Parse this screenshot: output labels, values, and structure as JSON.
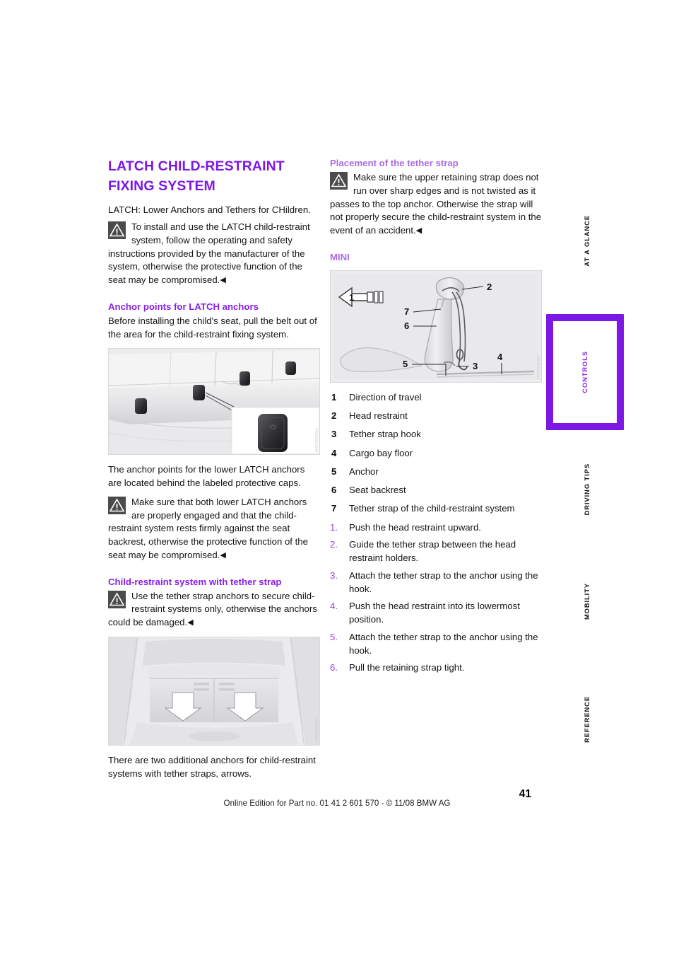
{
  "document": {
    "page_number": "41",
    "footer_text": "Online Edition for Part no. 01 41 2 601 570 - © 11/08 BMW AG"
  },
  "colors": {
    "heading_primary": "#7d17e6",
    "heading_secondary": "#8a1fe8",
    "heading_light": "#a96ce6",
    "step_number": "#9b3fe8",
    "active_tab": "#7d17e6"
  },
  "left_column": {
    "title": "LATCH CHILD-RESTRAINT FIXING SYSTEM",
    "intro": "LATCH: Lower Anchors and Tethers for CHildren.",
    "warning_1": "To install and use the LATCH child-restraint system, follow the operating and safety instructions provided by the manufacturer of the system, otherwise the protective function of the seat may be compromised.",
    "section_anchor_points": {
      "heading": "Anchor points for LATCH anchors",
      "paragraph": "Before installing the child's seat, pull the belt out of the area for the child-restraint fixing system.",
      "figure_caption": "The anchor points for the lower LATCH anchors are located behind the labeled protective caps.",
      "figure_credit": "VM01012005",
      "warning": "Make sure that both lower LATCH anchors are properly engaged and that the child-restraint system rests firmly against the seat backrest, otherwise the protective function of the seat may be compromised."
    },
    "section_tether_strap": {
      "heading": "Child-restraint system with tether strap",
      "warning": "Use the tether strap anchors to secure child-restraint systems only, otherwise the anchors could be damaged.",
      "figure_credit": "VM01012005",
      "figure_caption": "There are two additional anchors for child-restraint systems with tether straps, arrows."
    }
  },
  "right_column": {
    "section_placement": {
      "heading": "Placement of the tether strap",
      "warning": "Make sure the upper retaining strap does not run over sharp edges and is not twisted as it passes to the top anchor. Otherwise the strap will not properly secure the child-restraint system in the event of an accident."
    },
    "section_mini": {
      "heading": "MINI",
      "figure_credit": "VM01012005",
      "figure_callouts": [
        "1",
        "2",
        "3",
        "4",
        "5",
        "6",
        "7"
      ],
      "legend": [
        {
          "num": "1",
          "text": "Direction of travel"
        },
        {
          "num": "2",
          "text": "Head restraint"
        },
        {
          "num": "3",
          "text": "Tether strap hook"
        },
        {
          "num": "4",
          "text": "Cargo bay floor"
        },
        {
          "num": "5",
          "text": "Anchor"
        },
        {
          "num": "6",
          "text": "Seat backrest"
        },
        {
          "num": "7",
          "text": "Tether strap of the child-restraint system"
        }
      ],
      "steps": [
        {
          "num": "1.",
          "text": "Push the head restraint upward."
        },
        {
          "num": "2.",
          "text": "Guide the tether strap between the head restraint holders."
        },
        {
          "num": "3.",
          "text": "Attach the tether strap to the anchor using the hook."
        },
        {
          "num": "4.",
          "text": "Push the head restraint into its lowermost position."
        },
        {
          "num": "5.",
          "text": "Attach the tether strap to the anchor using the hook."
        },
        {
          "num": "6.",
          "text": "Pull the retaining strap tight."
        }
      ]
    }
  },
  "nav_tabs": [
    {
      "label": "AT A GLANCE",
      "active": false
    },
    {
      "label": "CONTROLS",
      "active": true
    },
    {
      "label": "DRIVING TIPS",
      "active": false
    },
    {
      "label": "MOBILITY",
      "active": false
    },
    {
      "label": "REFERENCE",
      "active": false
    }
  ]
}
